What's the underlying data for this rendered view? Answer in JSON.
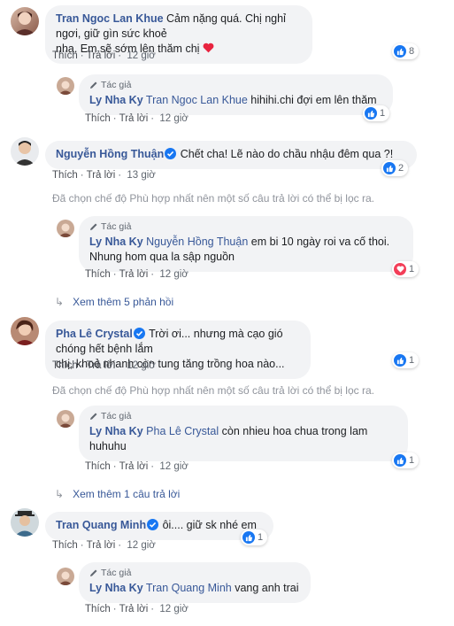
{
  "comments": [
    {
      "author": "Tran Ngoc Lan Khue",
      "text": "Cảm nặng quá. Chị nghỉ ngơi, giữ gìn sức khoẻ nha. Em sẽ sớm lên thăm chị",
      "text_line1": "Cảm nặng quá. Chị nghỉ ngơi, giữ gìn sức khoẻ",
      "text_line2": "nha. Em sẽ sớm lên thăm chị",
      "emoji": "heart",
      "like_label": "Thích",
      "reply_label": "Trả lời",
      "time": "12 giờ",
      "reaction_count": "8",
      "reaction": "like",
      "reply": {
        "badge": "Tác giả",
        "author": "Ly Nha Ky",
        "mention": "Tran Ngoc Lan Khue",
        "text": "hihihi.chi đợi em lên thăm",
        "like_label": "Thích",
        "reply_label": "Trả lời",
        "time": "12 giờ",
        "reaction_count": "1",
        "reaction": "like"
      }
    },
    {
      "author": "Nguyễn Hồng Thuận",
      "verified": true,
      "text": "Chết cha! Lẽ nào do chầu nhậu đêm qua ?!",
      "like_label": "Thích",
      "reply_label": "Trả lời",
      "time": "13 giờ",
      "reaction_count": "2",
      "reaction": "like",
      "filter_note": "Đã chọn chế độ Phù hợp nhất nên một số câu trả lời có thể bị lọc ra.",
      "reply": {
        "badge": "Tác giả",
        "author": "Ly Nha Ky",
        "mention": "Nguyễn Hồng Thuận",
        "text_line1": "em bi 10 ngày roi va cố thoi.",
        "text_line2": "Nhung hom qua la sập nguồn",
        "like_label": "Thích",
        "reply_label": "Trả lời",
        "time": "12 giờ",
        "reaction_count": "1",
        "reaction": "love"
      },
      "see_more": "Xem thêm 5 phản hồi"
    },
    {
      "author": "Pha Lê Crystal",
      "verified": true,
      "text_line1": "Trời ơi... nhưng mà cạo gió chóng hết bệnh lắm",
      "text_line2": "chị, khoẻ nhanh còn tung tăng trồng hoa nào...",
      "like_label": "Thích",
      "reply_label": "Trả lời",
      "time": "12 giờ",
      "reaction_count": "1",
      "reaction": "like",
      "filter_note": "Đã chọn chế độ Phù hợp nhất nên một số câu trả lời có thể bị lọc ra.",
      "reply": {
        "badge": "Tác giả",
        "author": "Ly Nha Ky",
        "mention": "Pha Lê Crystal",
        "text_line1": "còn nhieu hoa chua trong lam",
        "text_line2": "huhuhu",
        "like_label": "Thích",
        "reply_label": "Trả lời",
        "time": "12 giờ",
        "reaction_count": "1",
        "reaction": "like"
      },
      "see_more": "Xem thêm 1 câu trả lời"
    },
    {
      "author": "Tran Quang Minh",
      "verified": true,
      "text": "ôi.... giữ sk nhé em",
      "like_label": "Thích",
      "reply_label": "Trả lời",
      "time": "12 giờ",
      "reaction_count": "1",
      "reaction": "like",
      "reply": {
        "badge": "Tác giả",
        "author": "Ly Nha Ky",
        "mention": "Tran Quang Minh",
        "text": "vang anh trai",
        "like_label": "Thích",
        "reply_label": "Trả lời",
        "time": "12 giờ"
      }
    }
  ],
  "colors": {
    "link": "#385898",
    "bubble": "#f2f3f5",
    "meta": "#606770",
    "like_blue": "#1877f2",
    "love_red": "#f33e58"
  }
}
